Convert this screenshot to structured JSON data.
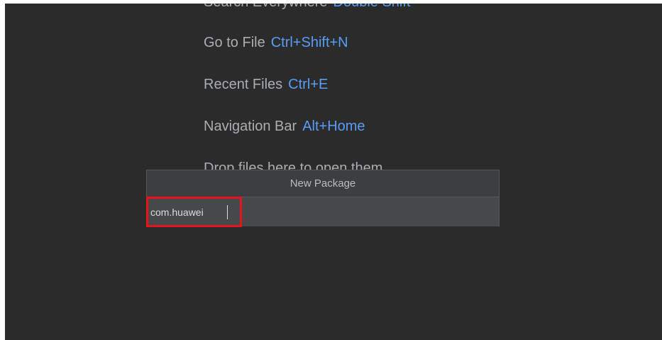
{
  "welcome_hints": [
    {
      "label": "Search Everywhere",
      "shortcut": "Double Shift"
    },
    {
      "label": "Go to File",
      "shortcut": "Ctrl+Shift+N"
    },
    {
      "label": "Recent Files",
      "shortcut": "Ctrl+E"
    },
    {
      "label": "Navigation Bar",
      "shortcut": "Alt+Home"
    },
    {
      "label": "Drop files here to open them",
      "shortcut": ""
    }
  ],
  "popup": {
    "title": "New Package",
    "input_value": "com.huawei"
  },
  "colors": {
    "background": "#2b2b2b",
    "hint_text": "#a9aeb4",
    "shortcut_text": "#589df6",
    "popup_background": "#3c3f41",
    "highlight": "#e8141b"
  }
}
